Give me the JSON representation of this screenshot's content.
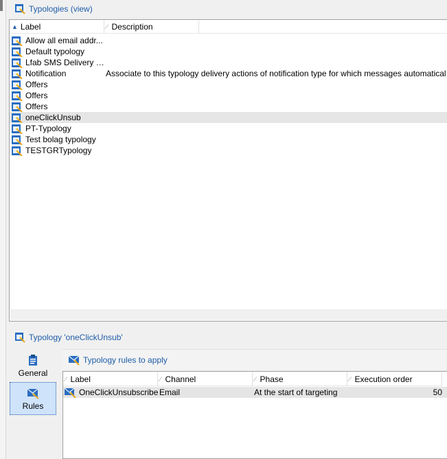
{
  "top_pane": {
    "title": "Typologies (view)",
    "columns": {
      "label": "Label",
      "description": "Description"
    },
    "rows": [
      {
        "label": "Allow all email addr...",
        "description": ""
      },
      {
        "label": "Default typology",
        "description": ""
      },
      {
        "label": "Lfab SMS Delivery typ.",
        "description": ""
      },
      {
        "label": "Notification",
        "description": "Associate to this typology delivery actions of notification type for which messages automatical"
      },
      {
        "label": "Offers",
        "description": ""
      },
      {
        "label": "Offers",
        "description": ""
      },
      {
        "label": "Offers",
        "description": ""
      },
      {
        "label": "oneClickUnsub",
        "description": "",
        "selected": true
      },
      {
        "label": "PT-Typology",
        "description": ""
      },
      {
        "label": "Test bolag typology",
        "description": ""
      },
      {
        "label": "TESTGRTypology",
        "description": ""
      }
    ]
  },
  "detail": {
    "title": "Typology 'oneClickUnsub'",
    "tabs": [
      {
        "label": "General",
        "icon": "clipboard-icon",
        "active": false
      },
      {
        "label": "Rules",
        "icon": "envelope-icon",
        "active": true
      }
    ],
    "rules": {
      "title": "Typology rules to apply",
      "columns": {
        "label": "Label",
        "channel": "Channel",
        "phase": "Phase",
        "execution_order": "Execution order"
      },
      "rows": [
        {
          "label": "OneClickUnsubscribe",
          "channel": "Email",
          "phase": "At the start of targeting",
          "execution_order": "50"
        }
      ]
    }
  },
  "colors": {
    "accent": "#1f5da8",
    "selected_row": "#e5e5e5",
    "active_tab": "#cfe3fb"
  }
}
